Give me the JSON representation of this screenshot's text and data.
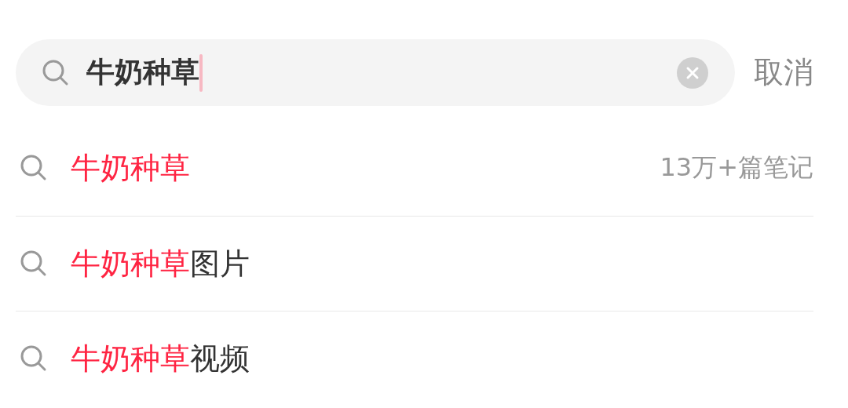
{
  "search": {
    "value": "牛奶种草",
    "cancel": "取消"
  },
  "suggestions": [
    {
      "match": "牛奶种草",
      "count": "13万+篇笔记"
    },
    {
      "match": "牛奶种草",
      "rest": "图片"
    },
    {
      "match": "牛奶种草",
      "rest": "视频"
    }
  ]
}
